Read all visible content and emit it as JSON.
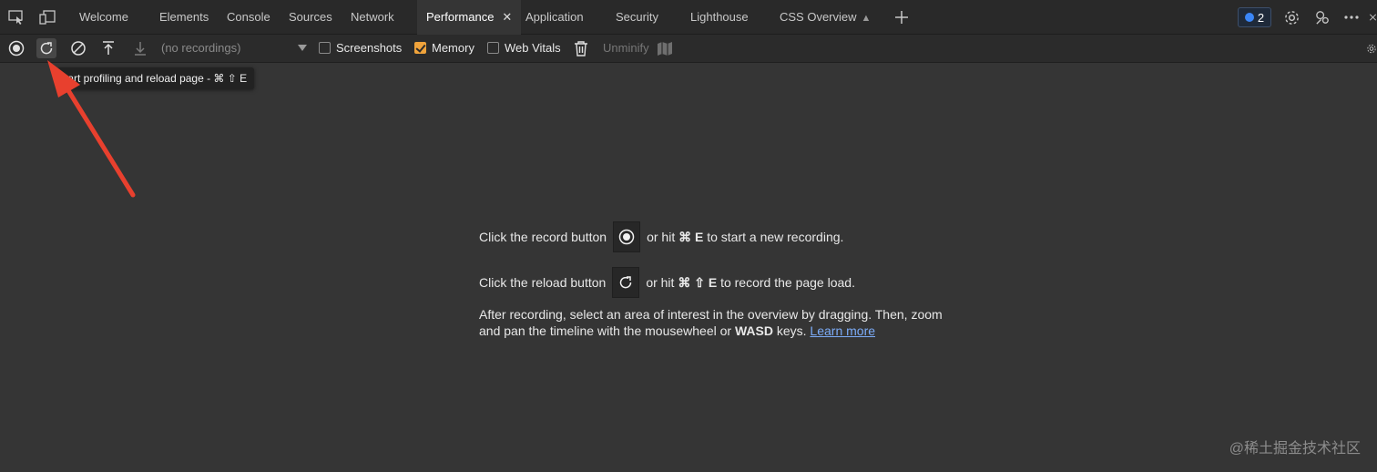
{
  "tabs": [
    {
      "label": "Welcome"
    },
    {
      "label": "Elements"
    },
    {
      "label": "Console"
    },
    {
      "label": "Sources"
    },
    {
      "label": "Network"
    },
    {
      "label": "Performance",
      "active": true
    },
    {
      "label": "Application"
    },
    {
      "label": "Security"
    },
    {
      "label": "Lighthouse"
    },
    {
      "label": "CSS Overview"
    }
  ],
  "issues_badge": {
    "count": "2"
  },
  "toolbar": {
    "recordings_select": "(no recordings)",
    "screenshots_label": "Screenshots",
    "screenshots_checked": false,
    "memory_label": "Memory",
    "memory_checked": true,
    "web_vitals_label": "Web Vitals",
    "web_vitals_checked": false,
    "unminify_label": "Unminify"
  },
  "tooltip": {
    "text": "tart profiling and reload page - ⌘ ⇧ E"
  },
  "landing": {
    "record_pre": "Click the record button",
    "record_mid": "or hit",
    "record_keys": "⌘ E",
    "record_post": "to start a new recording.",
    "reload_pre": "Click the reload button",
    "reload_mid": "or hit",
    "reload_keys": "⌘ ⇧ E",
    "reload_post": "to record the page load.",
    "para_1": "After recording, select an area of interest in the overview by dragging. Then, zoom and pan the timeline with the mousewheel or",
    "para_keys": "WASD",
    "para_2": "keys.",
    "learn_more": "Learn more"
  },
  "watermark": "@稀土掘金技术社区",
  "colors": {
    "accent_orange": "#f0a33b",
    "arrow_red": "#e8402e",
    "link_blue": "#7cacf8"
  }
}
